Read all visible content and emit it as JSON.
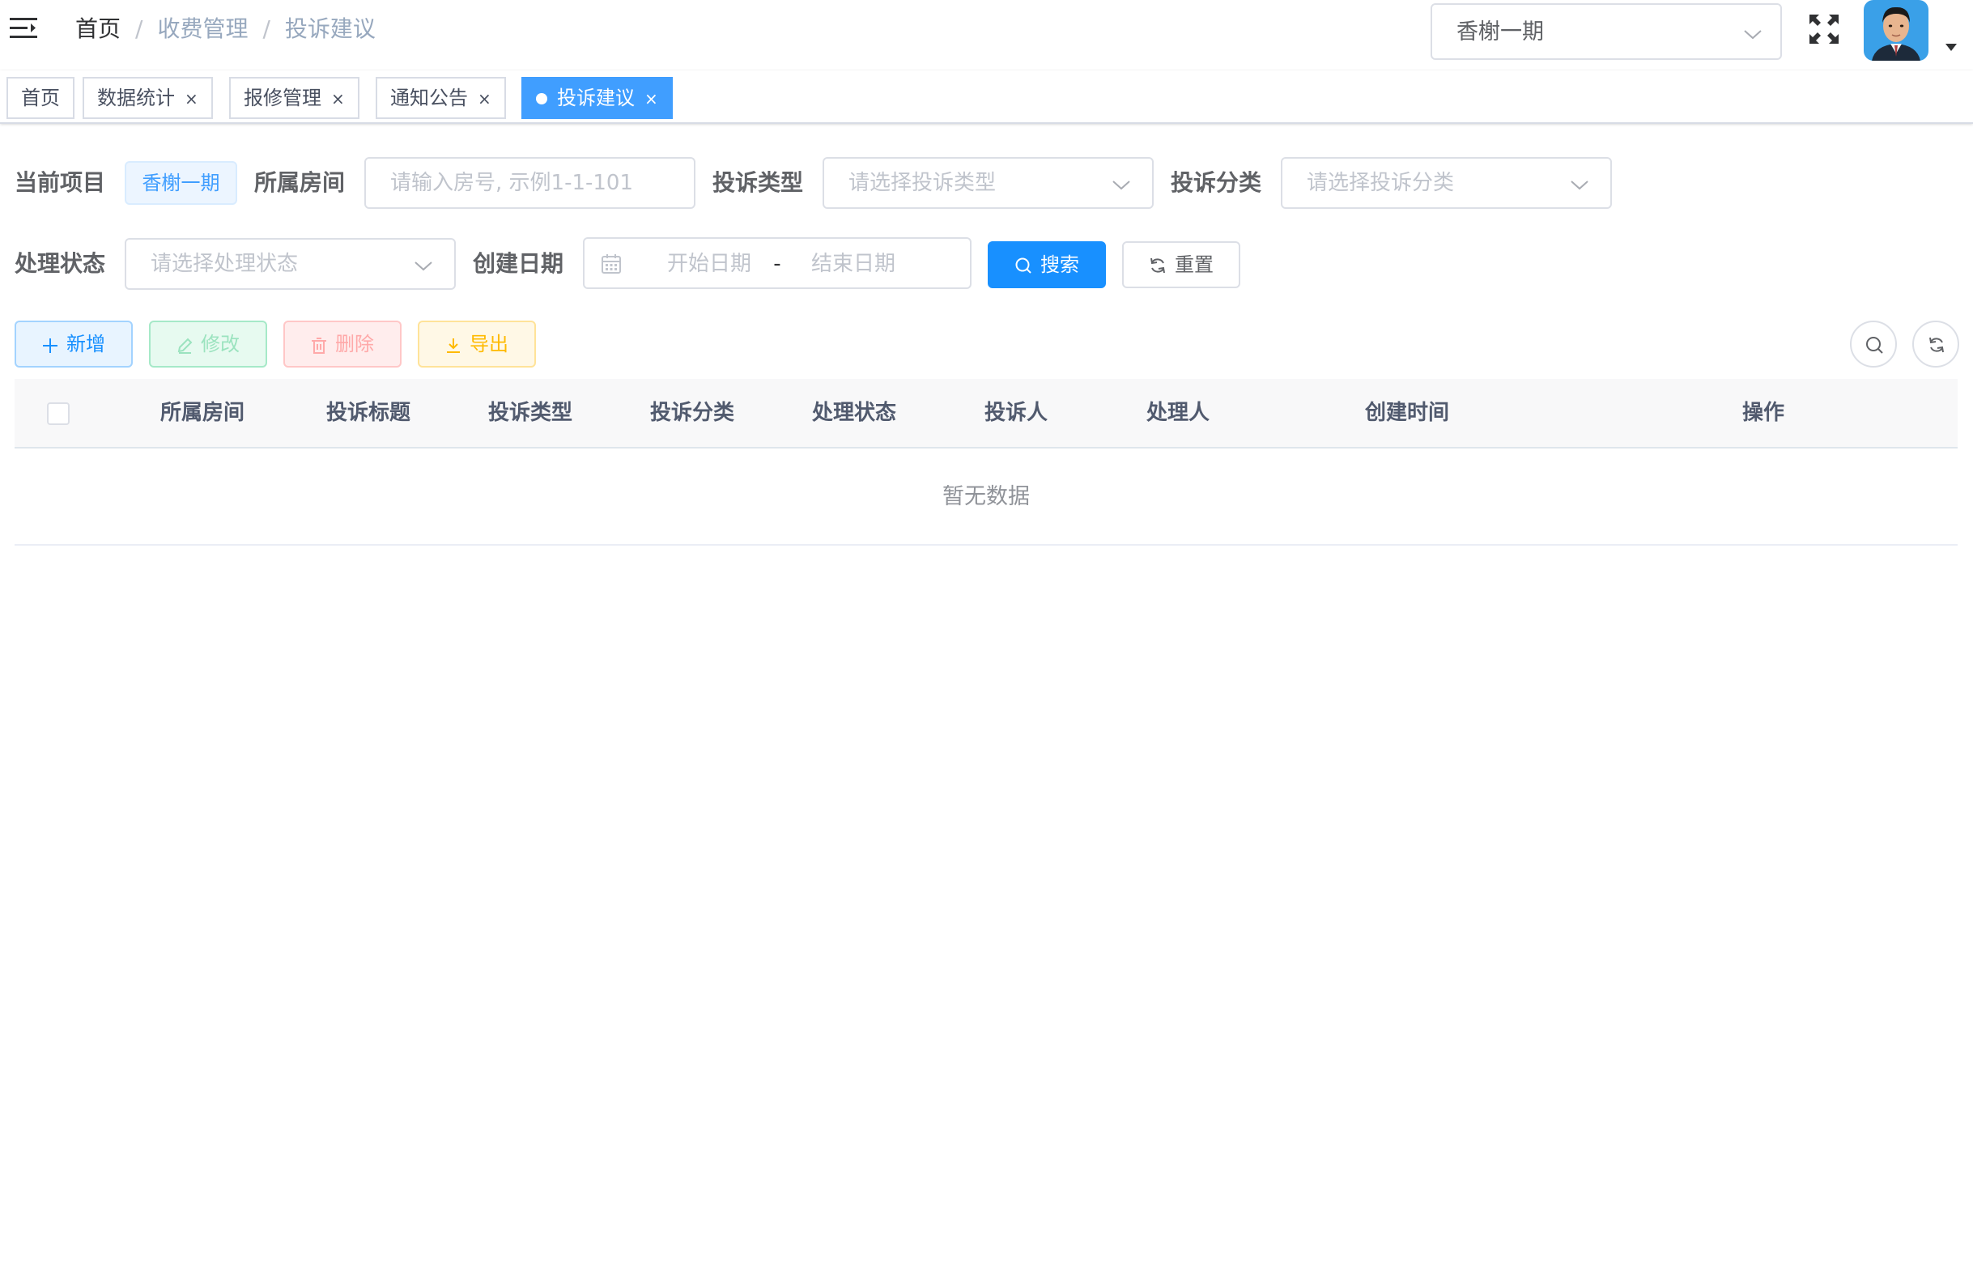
{
  "navbar": {
    "breadcrumb": [
      "首页",
      "收费管理",
      "投诉建议"
    ],
    "breadcrumb_separator": "/",
    "project_selector": "香榭一期"
  },
  "tags": [
    {
      "label": "首页",
      "closable": false,
      "active": false
    },
    {
      "label": "数据统计",
      "closable": true,
      "active": false
    },
    {
      "label": "报修管理",
      "closable": true,
      "active": false
    },
    {
      "label": "通知公告",
      "closable": true,
      "active": false
    },
    {
      "label": "投诉建议",
      "closable": true,
      "active": true
    }
  ],
  "tag_close_glyph": "×",
  "search": {
    "current_project_label": "当前项目",
    "current_project_value": "香榭一期",
    "room_label": "所属房间",
    "room_placeholder": "请输入房号, 示例1-1-101",
    "type_label": "投诉类型",
    "type_placeholder": "请选择投诉类型",
    "category_label": "投诉分类",
    "category_placeholder": "请选择投诉分类",
    "status_label": "处理状态",
    "status_placeholder": "请选择处理状态",
    "date_label": "创建日期",
    "date_start_placeholder": "开始日期",
    "date_separator": "-",
    "date_end_placeholder": "结束日期",
    "search_button": "搜索",
    "reset_button": "重置"
  },
  "toolbar": {
    "add": "新增",
    "edit": "修改",
    "delete": "删除",
    "export": "导出"
  },
  "table": {
    "columns": [
      "所属房间",
      "投诉标题",
      "投诉类型",
      "投诉分类",
      "处理状态",
      "投诉人",
      "处理人",
      "创建时间",
      "操作"
    ],
    "rows": [],
    "empty_text": "暂无数据"
  },
  "colors": {
    "primary": "#1890ff",
    "tag_active": "#409eff",
    "success": "#13ce66",
    "danger": "#ff4949",
    "warning": "#ffba00"
  }
}
